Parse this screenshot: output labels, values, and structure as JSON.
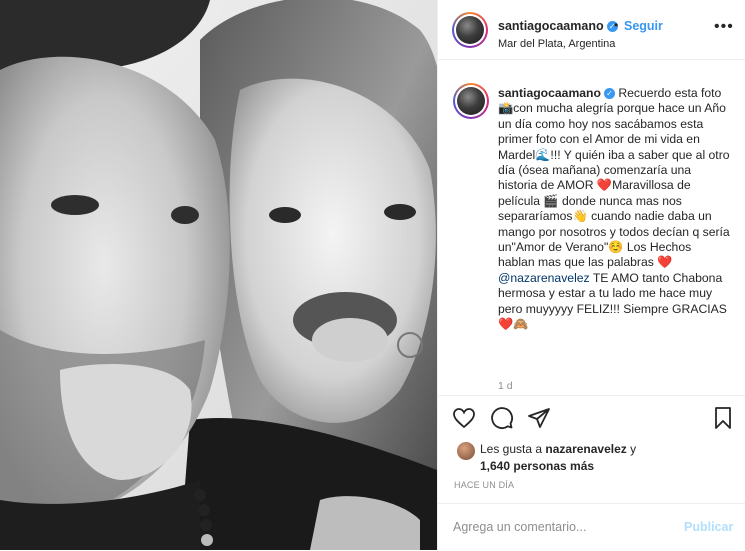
{
  "post": {
    "username": "santiagocaamano",
    "dot": "•",
    "follow_label": "Seguir",
    "location": "Mar del Plata, Argentina",
    "more_label": "•••",
    "verified_glyph": "✓"
  },
  "caption": {
    "username": "santiagocaamano",
    "text_part1": " Recuerdo esta foto 📸con mucha alegría porque hace un Año un día como hoy nos sacábamos esta primer foto con el Amor de mi vida en Mardel🌊!!! Y quién iba a saber que al otro día (ósea mañana) comenzaría una historia de AMOR ❤️Maravillosa de película 🎬 donde nunca mas nos separaríamos👋 cuando nadie daba un mango por nosotros y todos decían q sería un\"Amor de Verano\"☺️ Los Hechos hablan mas que las palabras ❤️ ",
    "mention": "@nazarenavelez",
    "text_part2": " TE AMO tanto Chabona hermosa y estar a tu lado me hace muy pero muyyyyy FELIZ!!! Siempre GRACIAS ❤️🙈",
    "time": "1 d"
  },
  "likes": {
    "prefix": "Les gusta a ",
    "user": "nazarenavelez",
    "suffix": " y",
    "count": "1,640 personas más"
  },
  "timeago": "HACE UN DÍA",
  "comment": {
    "placeholder": "Agrega un comentario...",
    "publish_label": "Publicar"
  },
  "icons": {
    "like": "heart-outline-icon",
    "comment": "comment-bubble-icon",
    "share": "paper-plane-icon",
    "save": "bookmark-icon"
  },
  "colors": {
    "accent": "#3897f0",
    "mention": "#00376b",
    "muted": "#8e8e8e",
    "publish_disabled": "#b2dffc"
  }
}
